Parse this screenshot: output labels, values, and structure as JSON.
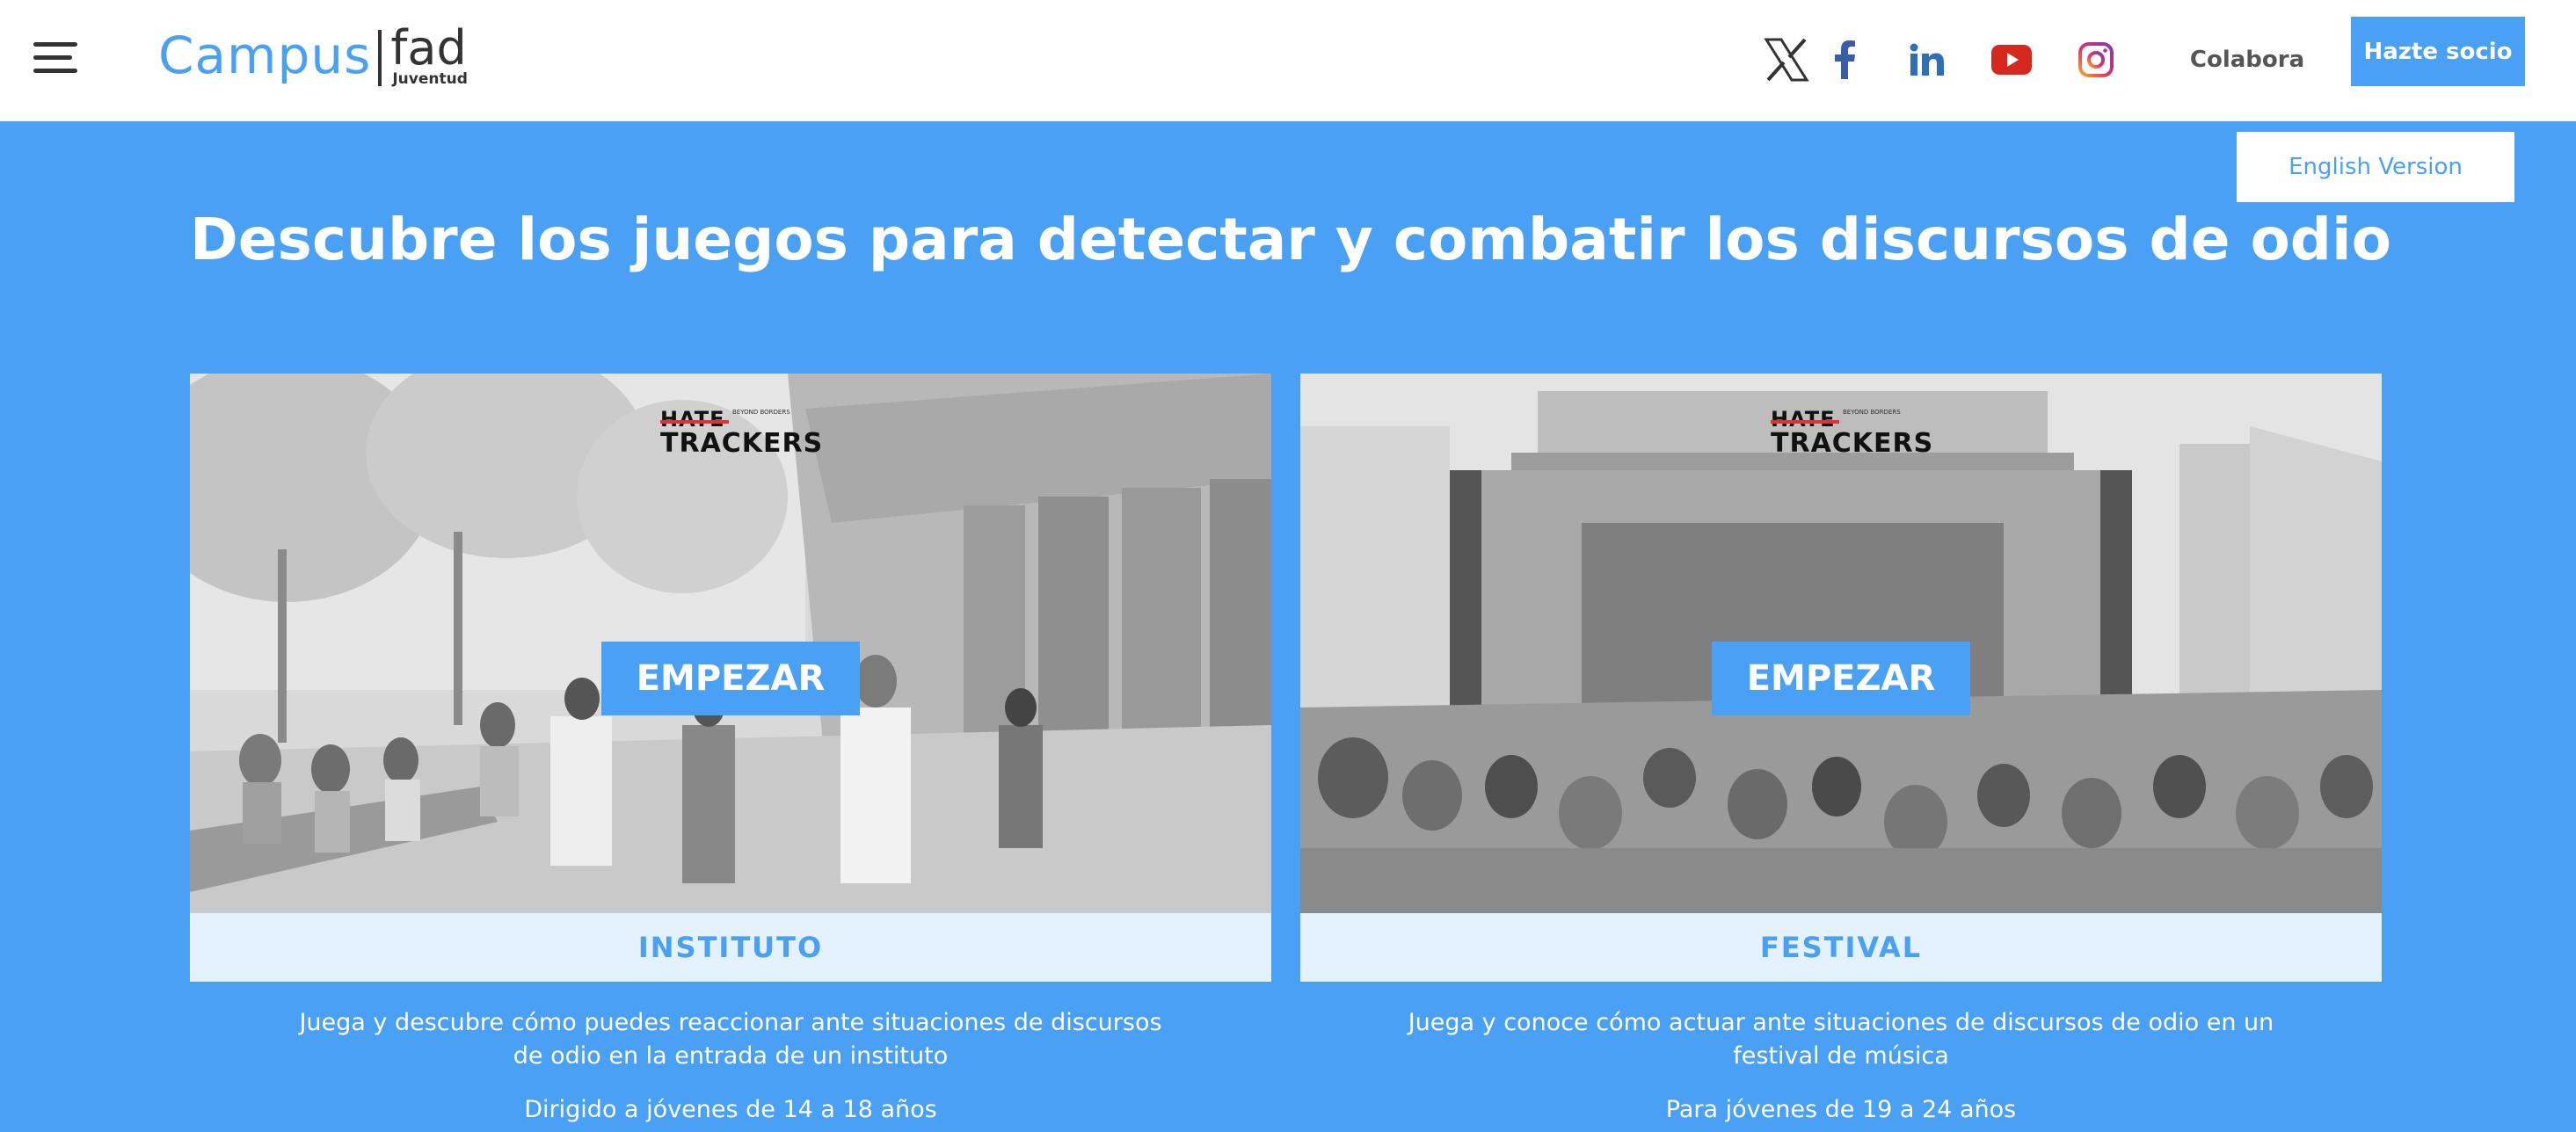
{
  "header": {
    "logo_main": "Campus",
    "logo_brand": "fad",
    "logo_sub": "Juventud",
    "social_icons": [
      "x-icon",
      "facebook-icon",
      "linkedin-icon",
      "youtube-icon",
      "instagram-icon"
    ],
    "colabora_label": "Colabora",
    "hazte_socio_label": "Hazte socio"
  },
  "language_button": "English Version",
  "page_title": "Descubre los juegos para detectar y combatir los discursos de odio",
  "cards": [
    {
      "logo_top": "HATE",
      "logo_bottom": "TRACKERS",
      "logo_tagline": "BEYOND BORDERS",
      "button_label": "EMPEZAR",
      "label": "INSTITUTO",
      "description": "Juega y descubre cómo puedes reaccionar ante situaciones de discursos de odio en la entrada de un instituto",
      "audience": "Dirigido a jóvenes de 14 a 18 años"
    },
    {
      "logo_top": "HATE",
      "logo_bottom": "TRACKERS",
      "logo_tagline": "BEYOND BORDERS",
      "button_label": "EMPEZAR",
      "label": "FESTIVAL",
      "description": "Juega y conoce cómo actuar ante situaciones de discursos de odio en un festival de música",
      "audience": "Para jóvenes de 19 a 24 años"
    }
  ],
  "colors": {
    "brand_blue": "#4aa0f5",
    "header_bg": "#ffffff",
    "text_dark": "#333333",
    "youtube_red": "#e62117",
    "linkedin_blue": "#0a66c2",
    "facebook_blue": "#1877f2"
  }
}
